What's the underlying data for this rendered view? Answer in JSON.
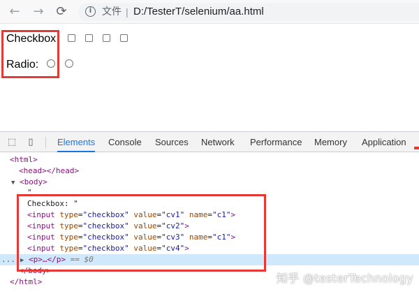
{
  "browser": {
    "back_icon": "arrow-left-icon",
    "forward_icon": "arrow-right-icon",
    "reload_icon": "reload-icon",
    "scheme_label": "文件",
    "separator": "|",
    "url": "D:/TesterT/selenium/aa.html"
  },
  "page": {
    "checkbox_label": "Checkbox",
    "radio_label": "Radio:",
    "checkbox_count": 4,
    "radio_count": 2
  },
  "devtools": {
    "tabs": [
      "Elements",
      "Console",
      "Sources",
      "Network",
      "Performance",
      "Memory",
      "Application"
    ],
    "active_tab": "Elements",
    "lines": {
      "html_open": "<html>",
      "head": "<head></head>",
      "body_open": "<body>",
      "quote": "\"",
      "checkbox_text": "Checkbox: \"",
      "inputs": [
        {
          "type": "checkbox",
          "value": "cv1",
          "name": "c1"
        },
        {
          "type": "checkbox",
          "value": "cv2",
          "name": ""
        },
        {
          "type": "checkbox",
          "value": "cv3",
          "name": "c1"
        },
        {
          "type": "checkbox",
          "value": "cv4",
          "name": ""
        }
      ],
      "p_collapsed": "<p>…</p>",
      "selected_marker": "== $0",
      "body_close": "</body>",
      "html_close": "</html>",
      "dots": "..."
    }
  },
  "watermark": "知乎 @testerTechnology",
  "colors": {
    "highlight": "#e53935",
    "tag": "#881280",
    "attr": "#994500",
    "value": "#1a1aa6",
    "selection": "#cfe8fc",
    "active_tab": "#1a73e8"
  }
}
